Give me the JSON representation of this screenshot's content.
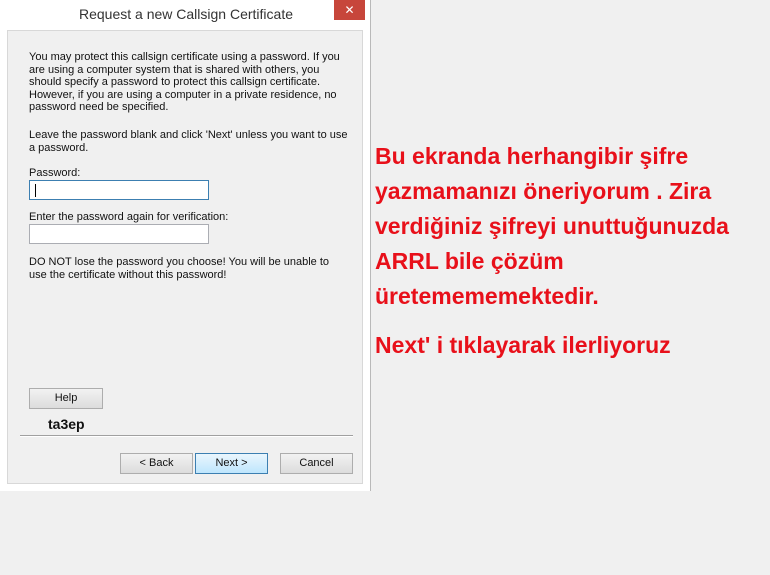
{
  "dialog": {
    "title": "Request a new Callsign Certificate",
    "close_glyph": "✕",
    "intro_text": "You may protect this callsign certificate using a password. If you are using a computer system that is shared with others, you should specify a password to protect this callsign certificate. However, if you are using a computer in a private residence, no password need be specified.",
    "hint_text": "Leave the password blank and click 'Next' unless you want to use a password.",
    "password_label": "Password:",
    "password_value": "",
    "verify_label": "Enter the password again for verification:",
    "verify_value": "",
    "warning_text": "DO NOT lose the password you choose! You will be unable to use the certificate without this password!",
    "help_label": "Help",
    "watermark": "ta3ep",
    "back_label": "< Back",
    "next_label": "Next >",
    "cancel_label": "Cancel"
  },
  "annotation": {
    "note": "Bu ekranda herhangibir şifre yazmamanızı öneriyorum . Zira verdiğiniz şifreyi unuttuğunuzda ARRL bile çözüm üretemememektedir.",
    "next_note": "Next' i tıklayarak ilerliyoruz"
  },
  "colors": {
    "annotation_red": "#e8101a",
    "close_button": "#c7463b",
    "focus_border": "#3c7fb1"
  }
}
